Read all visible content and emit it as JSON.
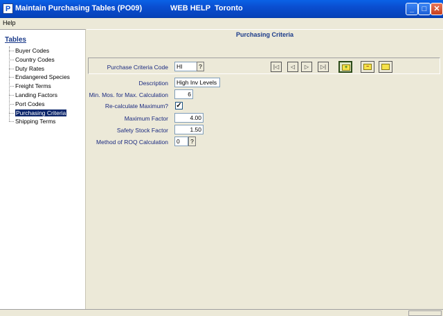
{
  "window": {
    "app_icon": "P",
    "title": "Maintain Purchasing Tables (PO09)",
    "help_label": "WEB HELP",
    "location": "Toronto",
    "icons": [
      "minimize-icon",
      "maximize-icon",
      "close-icon"
    ]
  },
  "menu": {
    "help": "Help"
  },
  "sidebar": {
    "header": "Tables",
    "items": [
      {
        "label": "Buyer Codes"
      },
      {
        "label": "Country Codes"
      },
      {
        "label": "Duty Rates"
      },
      {
        "label": "Endangered Species"
      },
      {
        "label": "Freight Terms"
      },
      {
        "label": "Landing Factors"
      },
      {
        "label": "Port Codes"
      },
      {
        "label": "Purchasing Criteria"
      },
      {
        "label": "Shipping Terms"
      }
    ],
    "selected": "Purchasing Criteria"
  },
  "main": {
    "title": "Purchasing Criteria",
    "code_label": "Purchase Criteria Code",
    "code_value": "HI",
    "lookup_label": "?",
    "fields": {
      "description_label": "Description",
      "description_value": "High Inv Levels",
      "min_mos_label": "Min. Mos. for Max. Calculation",
      "min_mos_value": "6",
      "recalc_label": "Re-calculate Maximum?",
      "recalc_checked": "✓",
      "max_factor_label": "Maximum Factor",
      "max_factor_value": "4.00",
      "safety_label": "Safety Stock Factor",
      "safety_value": "1.50",
      "roq_label": "Method of ROQ Calculation",
      "roq_value": "0"
    },
    "nav_icons": [
      "first-record-icon",
      "previous-record-icon",
      "next-record-icon",
      "last-record-icon"
    ],
    "nav_glyphs": [
      "|◁",
      "◁",
      "▷",
      "▷|"
    ],
    "tool_icons": [
      "add-record-icon",
      "delete-record-icon",
      "open-folder-icon"
    ],
    "tool_glyphs": [
      "+",
      "−",
      ""
    ]
  }
}
